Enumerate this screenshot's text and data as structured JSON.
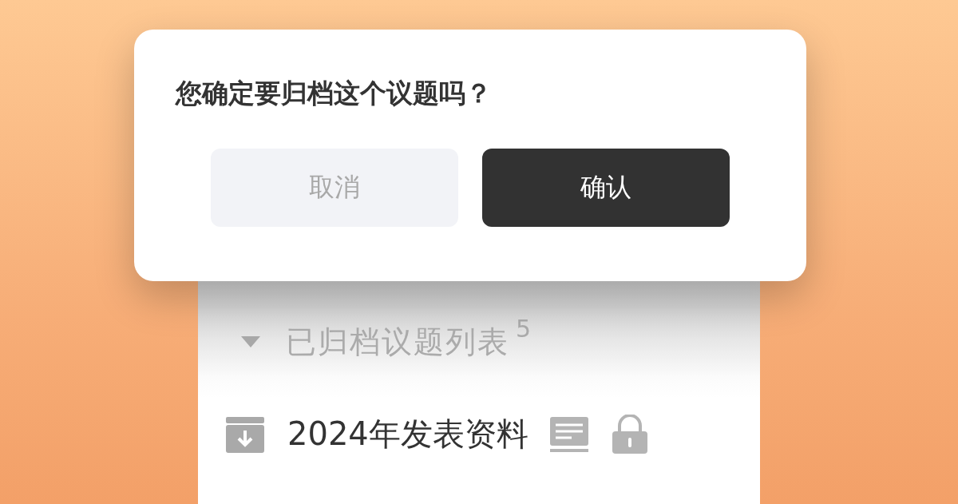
{
  "dialog": {
    "title": "您确定要归档这个议题吗？",
    "buttons": [
      {
        "label": "取消",
        "kind": "cancel"
      },
      {
        "label": "确认",
        "kind": "confirm"
      }
    ]
  },
  "section": {
    "title": "已归档议题列表",
    "count": "5",
    "expanded": true
  },
  "items": [
    {
      "title": "2024年发表资料"
    }
  ]
}
